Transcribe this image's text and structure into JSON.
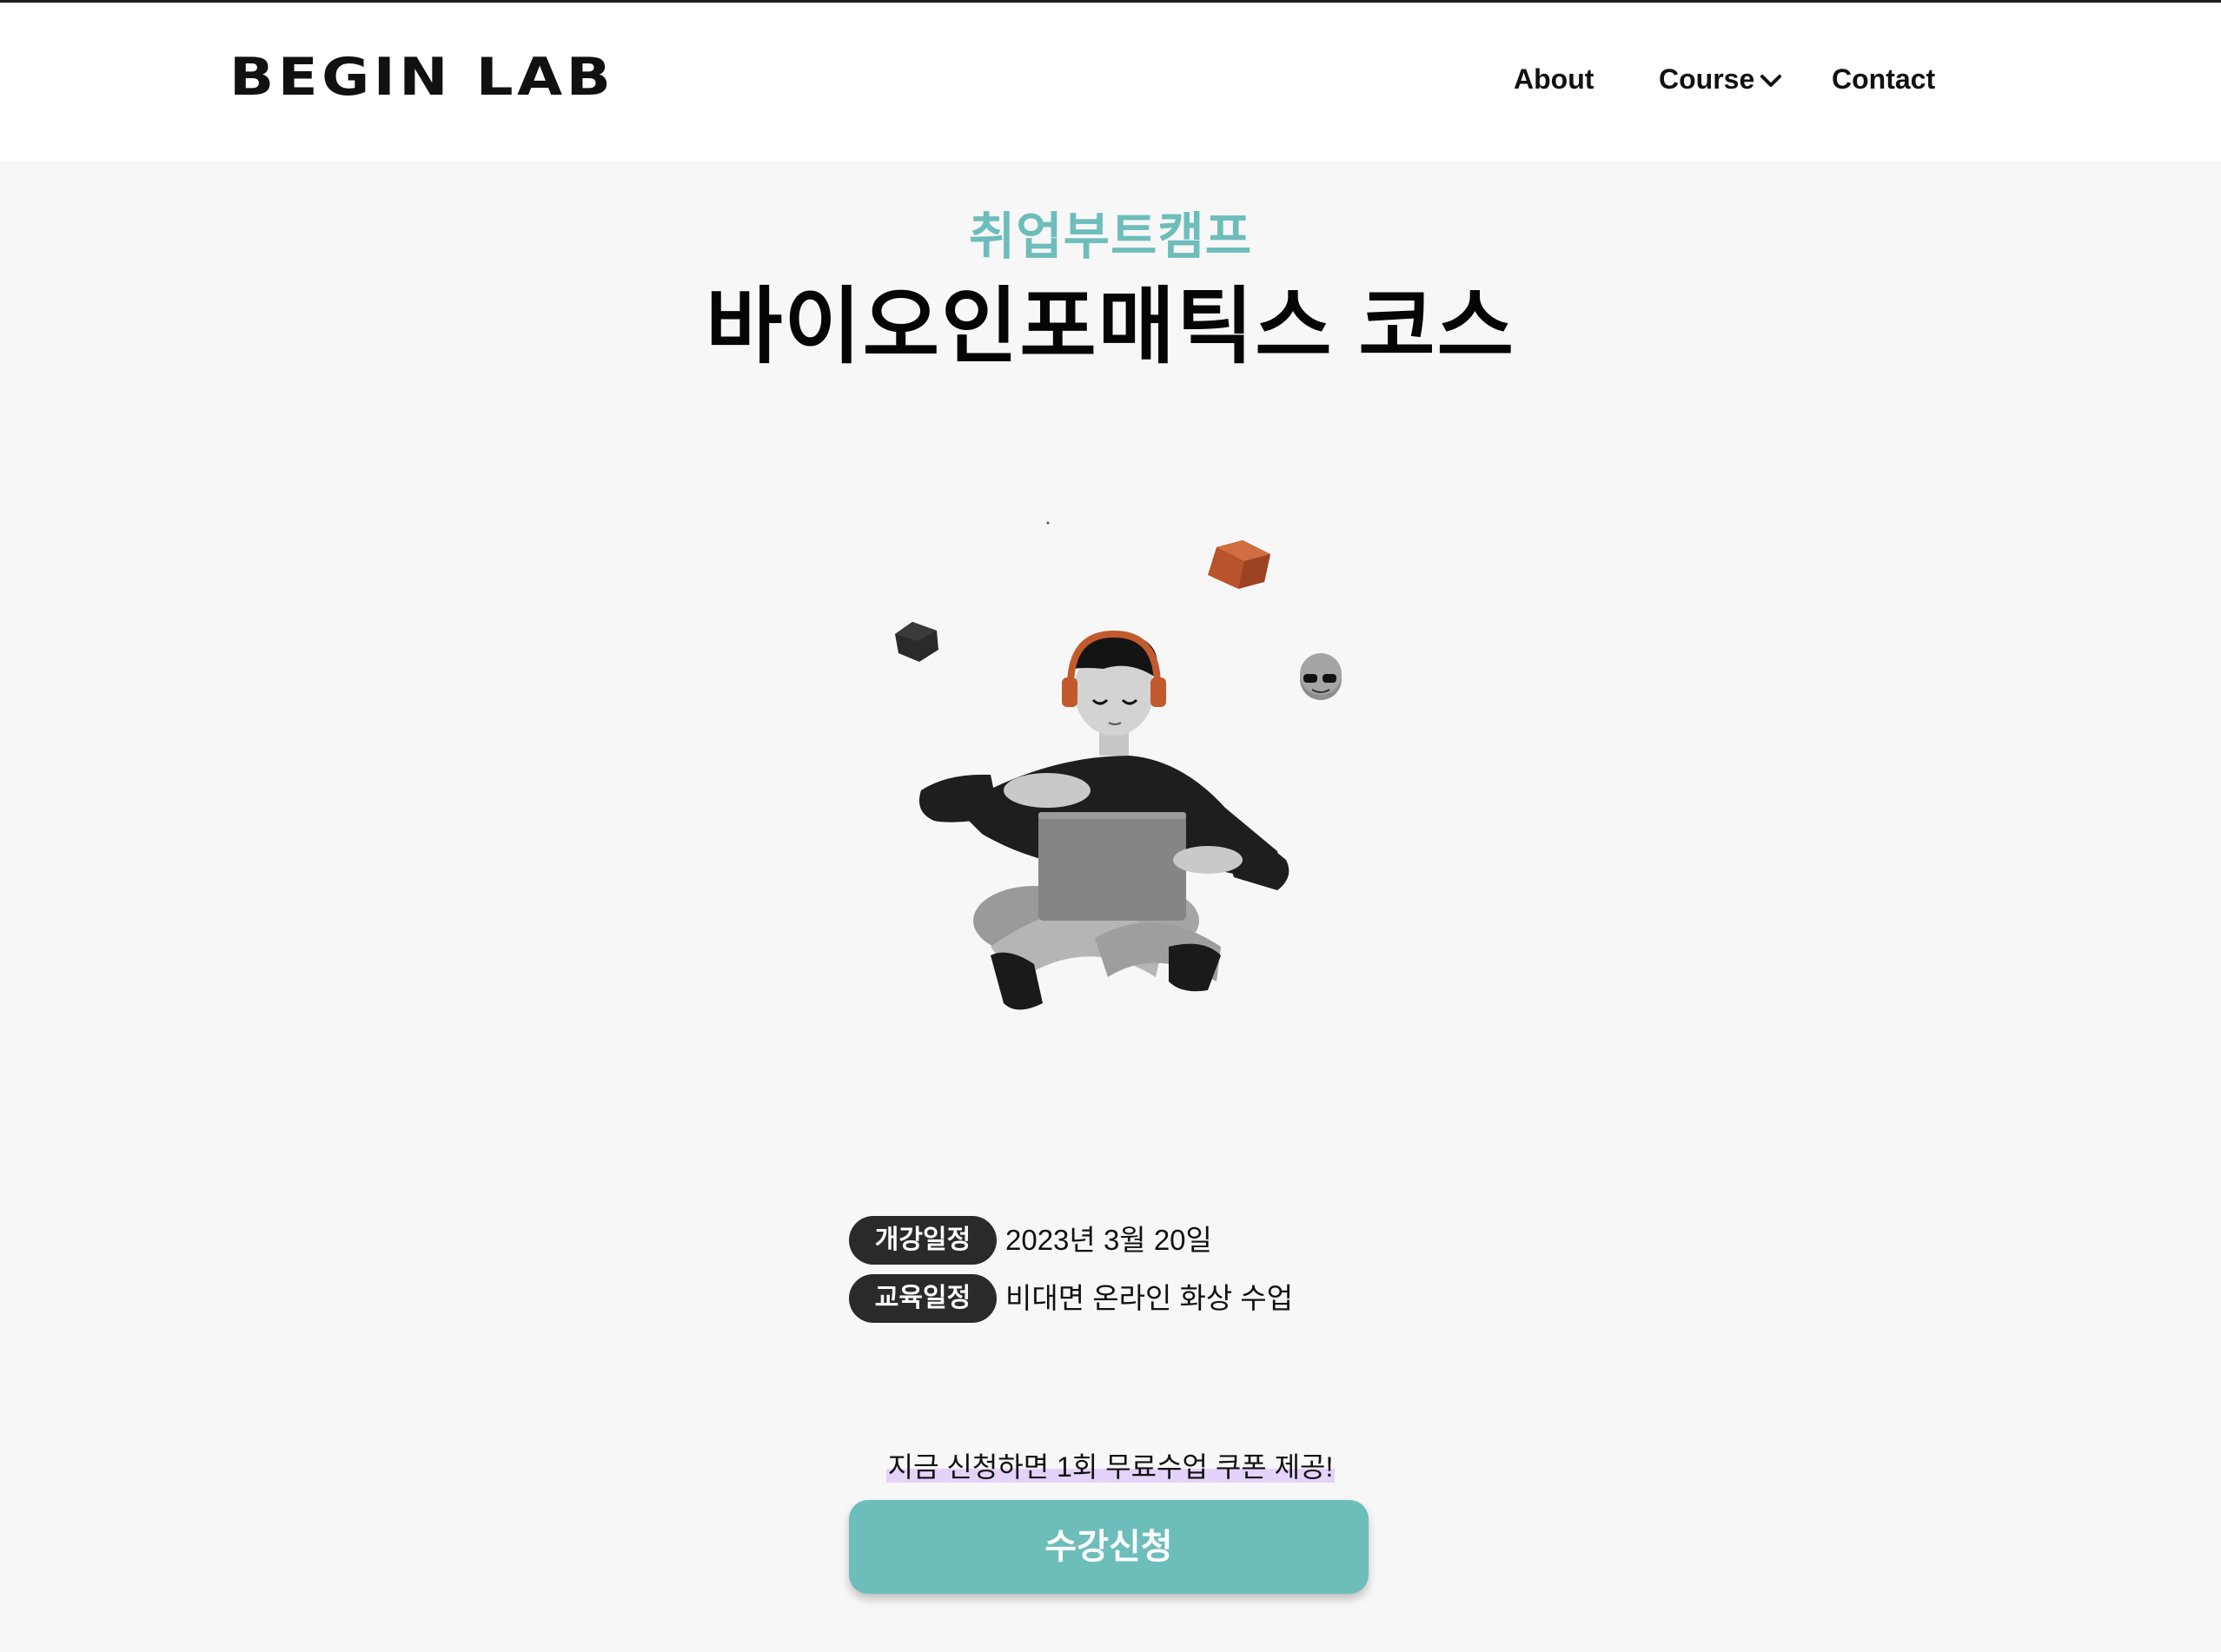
{
  "header": {
    "logo": "BEGIN LAB",
    "nav": {
      "about": "About",
      "course": "Course",
      "contact": "Contact"
    }
  },
  "hero": {
    "subtitle": "취업부트캠프",
    "title": "바이오인포매틱스 코스"
  },
  "info": [
    {
      "label": "개강일정",
      "value": "2023년 3월 20일"
    },
    {
      "label": "교육일정",
      "value": "비대면 온라인 화상 수업"
    }
  ],
  "promo": "지금 신청하면 1회 무료수업 쿠폰 제공!",
  "cta": "수강신청",
  "colors": {
    "accent": "#6dbdbb",
    "pill": "#2a2a2a",
    "highlight": "#e5d2fb",
    "background": "#f7f7f7"
  }
}
